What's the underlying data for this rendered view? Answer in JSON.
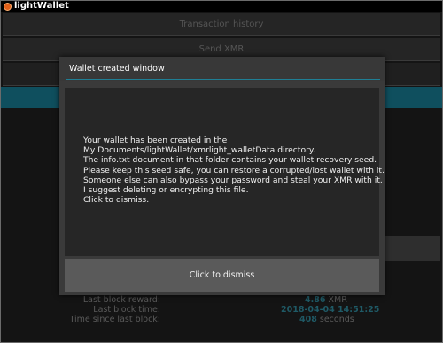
{
  "window": {
    "title": "lightWallet"
  },
  "nav": {
    "transaction_history": "Transaction history",
    "send_xmr": "Send XMR"
  },
  "stats": {
    "last_block_reward_label": "Last block reward:",
    "last_block_reward_value": "4.86",
    "last_block_reward_unit": "XMR",
    "last_block_time_label": "Last block time:",
    "last_block_time_value": "2018-04-04 14:51:25",
    "time_since_label": "Time since last block:",
    "time_since_value": "408",
    "time_since_unit": "seconds"
  },
  "modal": {
    "title": "Wallet created window",
    "lines": [
      "Your wallet has been created in the",
      "My Documents/lightWallet/xmrlight_walletData directory.",
      "The info.txt document in that folder contains your wallet recovery seed.",
      "Please keep this seed safe, you can restore a corrupted/lost wallet with it.",
      "Someone else can also bypass your password and steal your XMR with it.",
      "I suggest deleting or encrypting this file.",
      "Click to dismiss."
    ],
    "dismiss_button": "Click to dismiss"
  },
  "colors": {
    "accent_divider": "#1f7f95",
    "teal_bar": "#0f4f5e",
    "app_icon": "#e0601a"
  },
  "icons": {
    "app_icon": "monero-logo-icon"
  }
}
